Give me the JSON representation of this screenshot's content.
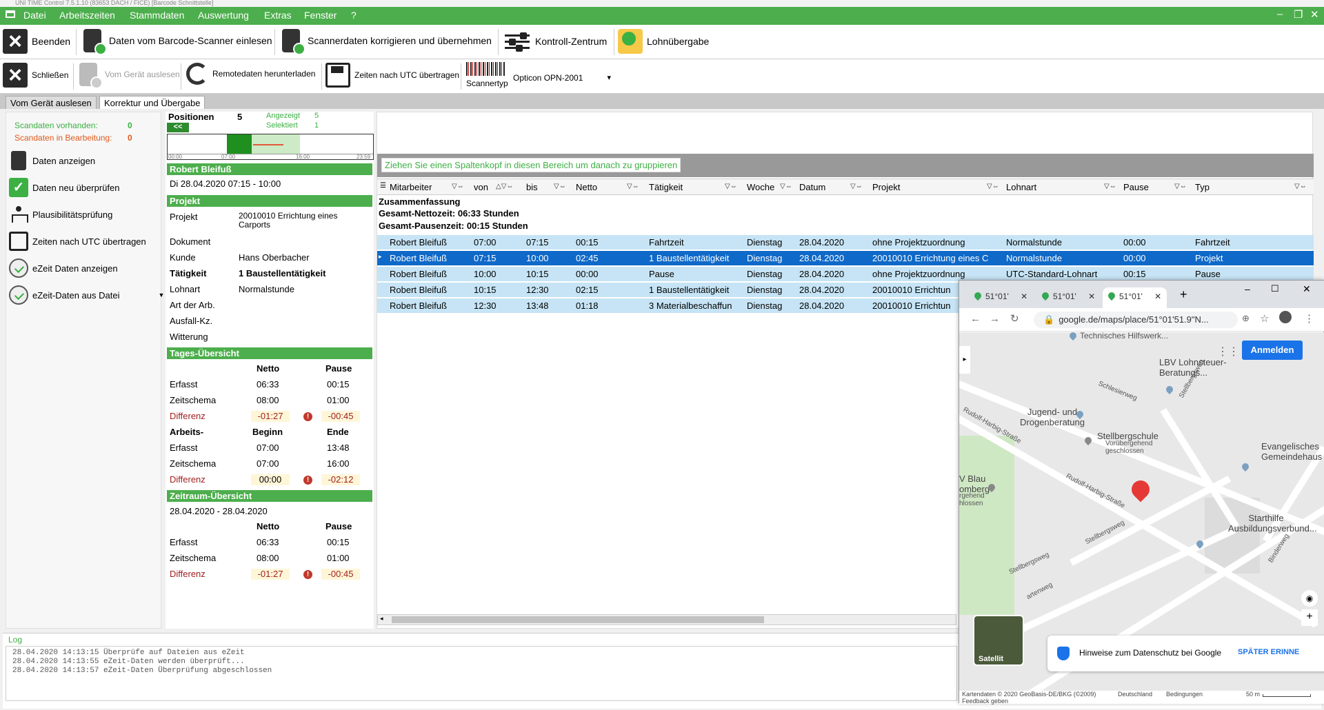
{
  "window_title": "UNI TIME Control 7.5.1.10 (83653 DACH / FICE)  [Barcode Schnittstelle]",
  "menu": [
    "Datei",
    "Arbeitszeiten",
    "Stammdaten",
    "Auswertung",
    "Extras",
    "Fenster",
    "?"
  ],
  "toolbar1": {
    "beenden": "Beenden",
    "daten_einlesen": "Daten vom Barcode-Scanner einlesen",
    "korrigieren": "Scannerdaten korrigieren und übernehmen",
    "kontroll": "Kontroll-Zentrum",
    "lohn": "Lohnübergabe"
  },
  "toolbar2": {
    "schliessen": "Schließen",
    "vom_geraet": "Vom Gerät auslesen",
    "remote": "Remotedaten herunterladen",
    "utc": "Zeiten nach UTC übertragen",
    "scannertyp": "Scannertyp",
    "scanner_value": "Opticon OPN-2001"
  },
  "tabs": [
    "Vom Gerät auslesen",
    "Korrektur und Übergabe"
  ],
  "leftnav": {
    "scandaten_label": "Scandaten vorhanden:",
    "scandaten_value": "0",
    "bearbeitung_label": "Scandaten in Bearbeitung:",
    "bearbeitung_value": "0",
    "items": [
      "Daten anzeigen",
      "Daten neu überprüfen",
      "Plausibilitätsprüfung",
      "Zeiten nach UTC übertragen",
      "eZeit Daten anzeigen",
      "eZeit-Daten aus Datei"
    ]
  },
  "positionen": {
    "label": "Positionen",
    "value": "5",
    "angezeigt_label": "Angezeigt",
    "angezeigt_value": "5",
    "selektiert_label": "Selektiert",
    "selektiert_value": "1",
    "back": "<<",
    "ticks": [
      "00:00",
      "07:00",
      "16:00",
      "23:59"
    ]
  },
  "detail": {
    "person": "Robert Bleifuß",
    "datum": "Di 28.04.2020    07:15 - 10:00",
    "projekt_hdr": "Projekt",
    "fields": [
      {
        "label": "Projekt",
        "value": "20010010 Errichtung eines Carports"
      },
      {
        "label": "Dokument",
        "value": ""
      },
      {
        "label": "Kunde",
        "value": "Hans Oberbacher"
      },
      {
        "label": "Tätigkeit",
        "value": "1 Baustellentätigkeit"
      },
      {
        "label": "Lohnart",
        "value": "Normalstunde"
      },
      {
        "label": "Art der Arb.",
        "value": ""
      },
      {
        "label": "Ausfall-Kz.",
        "value": ""
      },
      {
        "label": "Witterung",
        "value": ""
      }
    ]
  },
  "tages": {
    "hdr": "Tages-Übersicht",
    "col1": "Netto",
    "col2": "Pause",
    "rows": [
      {
        "l": "Erfasst",
        "a": "06:33",
        "b": "00:15"
      },
      {
        "l": "Zeitschema",
        "a": "08:00",
        "b": "01:00"
      }
    ],
    "diff": {
      "l": "Differenz",
      "a": "-01:27",
      "b": "-00:45"
    },
    "hdr2": {
      "l": "Arbeits-",
      "a": "Beginn",
      "b": "Ende"
    },
    "rows2": [
      {
        "l": "Erfasst",
        "a": "07:00",
        "b": "13:48"
      },
      {
        "l": "Zeitschema",
        "a": "07:00",
        "b": "16:00"
      }
    ],
    "diff2": {
      "l": "Differenz",
      "a": "00:00",
      "b": "-02:12"
    }
  },
  "zeitraum": {
    "hdr": "Zeitraum-Übersicht",
    "range": "28.04.2020 - 28.04.2020",
    "col1": "Netto",
    "col2": "Pause",
    "rows": [
      {
        "l": "Erfasst",
        "a": "06:33",
        "b": "00:15"
      },
      {
        "l": "Zeitschema",
        "a": "08:00",
        "b": "01:00"
      }
    ],
    "diff": {
      "l": "Differenz",
      "a": "-01:27",
      "b": "-00:45"
    }
  },
  "grid": {
    "group_hint": "Ziehen Sie einen Spaltenkopf in diesen Bereich um danach zu gruppieren",
    "columns": [
      "Mitarbeiter",
      "von",
      "bis",
      "Netto",
      "Tätigkeit",
      "Woche",
      "Datum",
      "Projekt",
      "Lohnart",
      "Pause",
      "Typ"
    ],
    "summary": [
      "Zusammenfassung",
      "Gesamt-Nettozeit: 06:33 Stunden",
      "Gesamt-Pausenzeit: 00:15 Stunden"
    ],
    "rows": [
      [
        "Robert Bleifuß",
        "07:00",
        "07:15",
        "00:15",
        "Fahrtzeit",
        "Dienstag",
        "28.04.2020",
        "ohne Projektzuordnung",
        "Normalstunde",
        "00:00",
        "Fahrtzeit"
      ],
      [
        "Robert Bleifuß",
        "07:15",
        "10:00",
        "02:45",
        "1 Baustellentätigkeit",
        "Dienstag",
        "28.04.2020",
        "20010010 Errichtung eines C",
        "Normalstunde",
        "00:00",
        "Projekt"
      ],
      [
        "Robert Bleifuß",
        "10:00",
        "10:15",
        "00:00",
        "Pause",
        "Dienstag",
        "28.04.2020",
        "ohne Projektzuordnung",
        "UTC-Standard-Lohnart",
        "00:15",
        "Pause"
      ],
      [
        "Robert Bleifuß",
        "10:15",
        "12:30",
        "02:15",
        "1 Baustellentätigkeit",
        "Dienstag",
        "28.04.2020",
        "20010010 Errichtun",
        "",
        "",
        ""
      ],
      [
        "Robert Bleifuß",
        "12:30",
        "13:48",
        "01:18",
        "3 Materialbeschaffun",
        "Dienstag",
        "28.04.2020",
        "20010010 Errichtun",
        "",
        "",
        ""
      ]
    ]
  },
  "log": {
    "label": "Log",
    "lines": [
      "28.04.2020 14:13:15   Überprüfe auf Dateien aus eZeit",
      "28.04.2020 14:13:55   eZeit-Daten werden überprüft...",
      "28.04.2020 14:13:57   eZeit-Daten Überprüfung abgeschlossen"
    ]
  },
  "browser": {
    "tabs": [
      "51°01'",
      "51°01'",
      "51°01'"
    ],
    "url": "google.de/maps/place/51°01'51.9\"N...",
    "anmelden": "Anmelden",
    "map_labels": [
      "Technisches Hilfswerk...",
      "LBV Lohnsteuer-Beratungs...",
      "Jugend- und Drogenberatung",
      "Stellbergschule",
      "Vorübergehend geschlossen",
      "Evangelisches Gemeindehaus",
      "Rudolf-Harbig-Straße",
      "Rudolf-Harbig-Straße",
      "Schlesierweg",
      "Stellbergsweg",
      "Stellbergsweg",
      "Starthilfe Ausbildungsverbund...",
      "V Blau omberg",
      "rgehend hlossen",
      "Binderweg",
      "Stellbergsweg",
      "artenweg"
    ],
    "satellit": "Satellit",
    "privacy": "Hinweise zum Datenschutz bei Google",
    "spaeter": "SPÄTER ERINNE",
    "footer": [
      "Kartendaten © 2020 GeoBasis-DE/BKG (©2009)",
      "Deutschland",
      "Bedingungen",
      "50 m",
      "Feedback geben"
    ]
  }
}
